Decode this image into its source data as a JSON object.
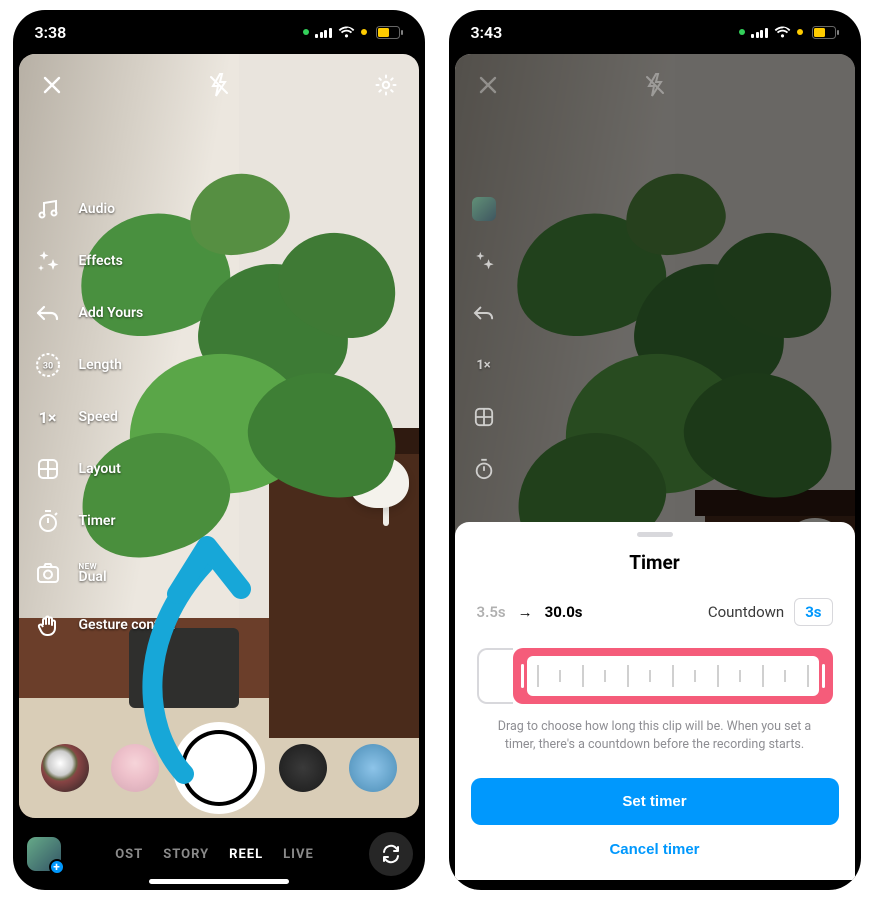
{
  "left": {
    "status": {
      "time": "3:38"
    },
    "side": {
      "audio": "Audio",
      "effects": "Effects",
      "add_yours": "Add Yours",
      "length": "Length",
      "speed": "Speed",
      "layout": "Layout",
      "timer": "Timer",
      "dual_new": "NEW",
      "dual": "Dual",
      "gesture": "Gesture control"
    },
    "tabs": {
      "post": "OST",
      "story": "STORY",
      "reel": "REEL",
      "live": "LIVE"
    }
  },
  "right": {
    "status": {
      "time": "3:43"
    },
    "mini": {
      "speed": "1×"
    },
    "sheet": {
      "title": "Timer",
      "start": "3.5s",
      "end": "30.0s",
      "countdown_label": "Countdown",
      "countdown_value": "3s",
      "hint": "Drag to choose how long this clip will be. When you set a timer, there's a countdown before the recording starts.",
      "set": "Set timer",
      "cancel": "Cancel timer"
    }
  }
}
